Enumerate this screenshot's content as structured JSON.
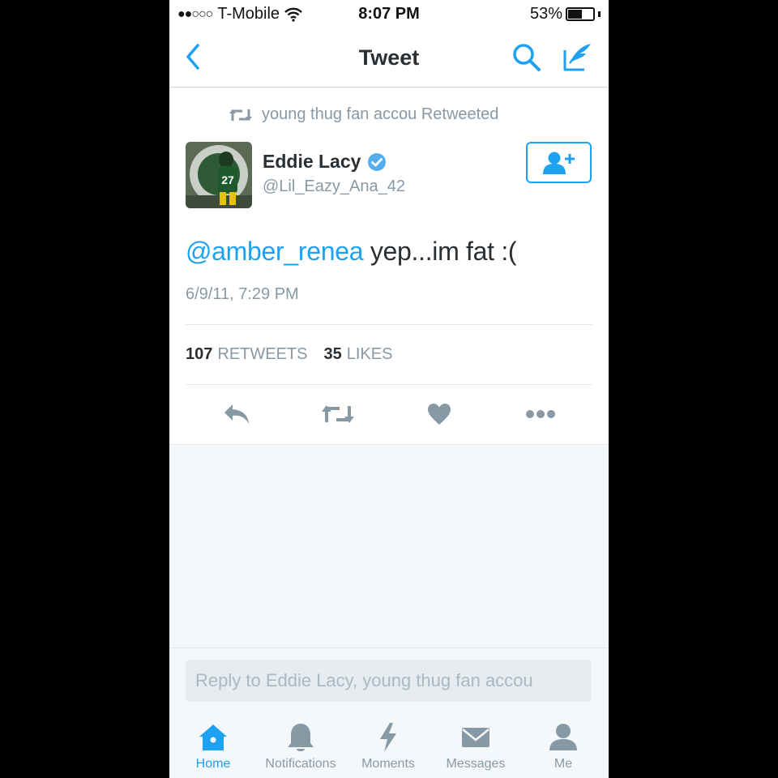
{
  "status_bar": {
    "signal": "●●○○○",
    "carrier": "T-Mobile",
    "time": "8:07 PM",
    "battery_percent": "53%",
    "battery_level": 0.53
  },
  "nav": {
    "title": "Tweet",
    "icons": [
      "chevron-left-icon",
      "search-icon",
      "compose-icon"
    ]
  },
  "tweet": {
    "retweet_context": "young thug fan accou Retweeted",
    "author_name": "Eddie Lacy",
    "verified": true,
    "author_handle": "@Lil_Eazy_Ana_42",
    "mention": "@amber_renea",
    "text": " yep...im fat :(",
    "timestamp": "6/9/11, 7:29 PM",
    "retweets_count": "107",
    "retweets_label": "RETWEETS",
    "likes_count": "35",
    "likes_label": "LIKES"
  },
  "reply": {
    "placeholder": "Reply to Eddie Lacy, young thug fan accou"
  },
  "tabs": [
    {
      "label": "Home",
      "icon": "home-icon",
      "active": true
    },
    {
      "label": "Notifications",
      "icon": "bell-icon",
      "active": false
    },
    {
      "label": "Moments",
      "icon": "lightning-icon",
      "active": false
    },
    {
      "label": "Messages",
      "icon": "envelope-icon",
      "active": false
    },
    {
      "label": "Me",
      "icon": "person-icon",
      "active": false
    }
  ],
  "colors": {
    "accent": "#1da1f2",
    "muted": "#8899a6",
    "text": "#292f33",
    "verified": "#55acee"
  }
}
